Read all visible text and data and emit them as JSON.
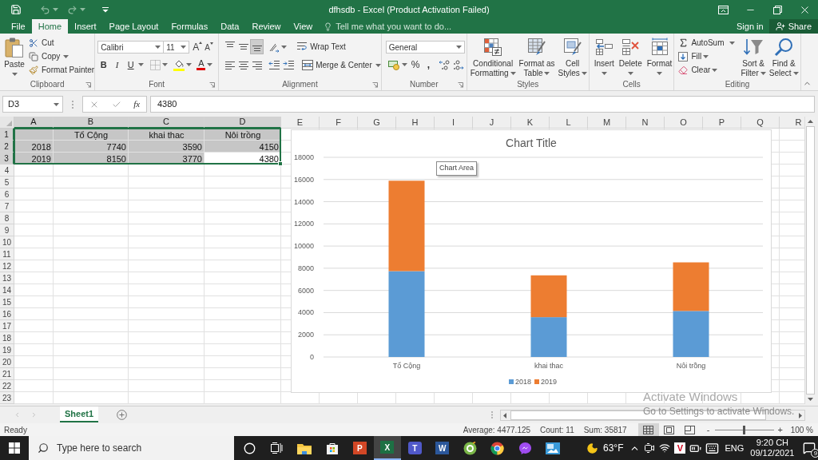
{
  "title_bar": {
    "title": "dfhsdb - Excel (Product Activation Failed)"
  },
  "ribbon_tabs": [
    {
      "label": "File",
      "selected": false
    },
    {
      "label": "Home",
      "selected": true
    },
    {
      "label": "Insert",
      "selected": false
    },
    {
      "label": "Page Layout",
      "selected": false
    },
    {
      "label": "Formulas",
      "selected": false
    },
    {
      "label": "Data",
      "selected": false
    },
    {
      "label": "Review",
      "selected": false
    },
    {
      "label": "View",
      "selected": false
    }
  ],
  "tell_me": {
    "placeholder": "Tell me what you want to do..."
  },
  "account": {
    "sign_in": "Sign in",
    "share": "Share"
  },
  "ribbon": {
    "clipboard": {
      "label": "Clipboard",
      "paste": "Paste",
      "cut": "Cut",
      "copy": "Copy",
      "format_painter": "Format Painter"
    },
    "font": {
      "label": "Font",
      "font_name": "Calibri",
      "font_size": "11",
      "grow": "A",
      "shrink": "A",
      "bold": "B",
      "italic": "I",
      "underline": "U",
      "font_color": "A"
    },
    "alignment": {
      "label": "Alignment",
      "vertical_align": [
        {
          "kind": "top",
          "selected": false
        },
        {
          "kind": "middle",
          "selected": false
        },
        {
          "kind": "bottom",
          "selected": true
        }
      ],
      "horizontal_align": [
        {
          "kind": "left",
          "selected": false
        },
        {
          "kind": "center",
          "selected": false
        },
        {
          "kind": "right",
          "selected": false
        }
      ],
      "wrap_text": "Wrap Text",
      "merge_center": "Merge & Center"
    },
    "number": {
      "label": "Number",
      "format": "General",
      "percent": "%",
      "comma": ","
    },
    "styles": {
      "label": "Styles",
      "buttons": [
        {
          "kind": "conditional",
          "lines": [
            "Conditional",
            "Formatting"
          ]
        },
        {
          "kind": "table",
          "lines": [
            "Format as",
            "Table"
          ]
        },
        {
          "kind": "cell_styles",
          "lines": [
            "Cell",
            "Styles"
          ]
        }
      ]
    },
    "cells": {
      "label": "Cells",
      "buttons": [
        {
          "kind": "insert",
          "label": "Insert"
        },
        {
          "kind": "delete",
          "label": "Delete"
        },
        {
          "kind": "format",
          "label": "Format"
        }
      ]
    },
    "editing": {
      "label": "Editing",
      "autosum": "AutoSum",
      "fill": "Fill",
      "clear": "Clear",
      "buttons": [
        {
          "kind": "sort",
          "lines": [
            "Sort &",
            "Filter"
          ]
        },
        {
          "kind": "find",
          "lines": [
            "Find &",
            "Select"
          ]
        }
      ]
    }
  },
  "formula_bar": {
    "name_box": "D3",
    "function_label": "fx",
    "value": "4380"
  },
  "sheet": {
    "columns": [
      {
        "label": "A",
        "selected": true
      },
      {
        "label": "B",
        "selected": true
      },
      {
        "label": "C",
        "selected": true
      },
      {
        "label": "D",
        "selected": true
      },
      {
        "label": "E",
        "selected": false
      },
      {
        "label": "F",
        "selected": false
      },
      {
        "label": "G",
        "selected": false
      },
      {
        "label": "H",
        "selected": false
      },
      {
        "label": "I",
        "selected": false
      },
      {
        "label": "J",
        "selected": false
      },
      {
        "label": "K",
        "selected": false
      },
      {
        "label": "L",
        "selected": false
      },
      {
        "label": "M",
        "selected": false
      },
      {
        "label": "N",
        "selected": false
      },
      {
        "label": "O",
        "selected": false
      },
      {
        "label": "P",
        "selected": false
      },
      {
        "label": "Q",
        "selected": false
      },
      {
        "label": "R",
        "selected": false
      }
    ],
    "rows": [
      {
        "label": "1",
        "selected": true,
        "cells": [
          {
            "selected": true,
            "active": false
          },
          {
            "text": "Tổ Cộng",
            "kind": "heading",
            "selected": true,
            "active": false
          },
          {
            "text": "khai thac",
            "kind": "heading",
            "selected": true,
            "active": false
          },
          {
            "text": "Nôi trồng",
            "kind": "heading",
            "selected": true,
            "active": false
          }
        ]
      },
      {
        "label": "2",
        "selected": true,
        "cells": [
          {
            "text": "2018",
            "kind": "number",
            "selected": true,
            "active": false
          },
          {
            "text": "7740",
            "kind": "number",
            "selected": true,
            "active": false
          },
          {
            "text": "3590",
            "kind": "number",
            "selected": true,
            "active": false
          },
          {
            "text": "4150",
            "kind": "number",
            "selected": true,
            "active": false
          }
        ]
      },
      {
        "label": "3",
        "selected": true,
        "cells": [
          {
            "text": "2019",
            "kind": "number",
            "selected": true,
            "active": false
          },
          {
            "text": "8150",
            "kind": "number",
            "selected": true,
            "active": false
          },
          {
            "text": "3770",
            "kind": "number",
            "selected": true,
            "active": false
          },
          {
            "text": "4380",
            "kind": "number",
            "selected": true,
            "active": true
          }
        ]
      },
      {
        "label": "4",
        "selected": false
      },
      {
        "label": "5",
        "selected": false
      },
      {
        "label": "6",
        "selected": false
      },
      {
        "label": "7",
        "selected": false
      },
      {
        "label": "8",
        "selected": false
      },
      {
        "label": "9",
        "selected": false
      },
      {
        "label": "10",
        "selected": false
      },
      {
        "label": "11",
        "selected": false
      },
      {
        "label": "12",
        "selected": false
      },
      {
        "label": "13",
        "selected": false
      },
      {
        "label": "14",
        "selected": false
      },
      {
        "label": "15",
        "selected": false
      },
      {
        "label": "16",
        "selected": false
      },
      {
        "label": "17",
        "selected": false
      },
      {
        "label": "18",
        "selected": false
      },
      {
        "label": "19",
        "selected": false
      },
      {
        "label": "20",
        "selected": false
      },
      {
        "label": "21",
        "selected": false
      },
      {
        "label": "22",
        "selected": false
      },
      {
        "label": "23",
        "selected": false
      }
    ]
  },
  "chart": {
    "tooltip": "Chart Area",
    "chart_data": {
      "type": "bar",
      "title": "Chart Title",
      "categories": [
        "Tổ Cộng",
        "khai thac",
        "Nôi trồng"
      ],
      "series": [
        {
          "name": "2018",
          "color": "#5b9bd5",
          "values": [
            7740,
            3590,
            4150
          ]
        },
        {
          "name": "2019",
          "color": "#ed7d31",
          "values": [
            8150,
            3770,
            4380
          ]
        }
      ],
      "ylim": [
        0,
        18000
      ],
      "yticks": [
        0,
        2000,
        4000,
        6000,
        8000,
        10000,
        12000,
        14000,
        16000,
        18000
      ],
      "stacked": true,
      "orientation": "vertical",
      "grid": true,
      "legend": true
    }
  },
  "sheet_tabs": [
    {
      "label": "Sheet1",
      "selected": true
    }
  ],
  "status_bar": {
    "mode": "Ready",
    "average": "Average: 4477.125",
    "count": "Count: 11",
    "sum": "Sum: 35817",
    "views": [
      {
        "kind": "normal",
        "selected": true
      },
      {
        "kind": "page_layout",
        "selected": false
      },
      {
        "kind": "page_break",
        "selected": false
      }
    ],
    "zoom": {
      "minus": "-",
      "plus": "+",
      "level": 0.5,
      "reading": "100 %"
    }
  },
  "taskbar": {
    "search": {
      "placeholder": "Type here to search"
    },
    "buttons": [
      {
        "kind": "cortana",
        "selected": false
      },
      {
        "kind": "task_view",
        "selected": false
      },
      {
        "kind": "folder",
        "selected": false
      },
      {
        "kind": "store",
        "selected": false
      },
      {
        "kind": "slides",
        "glyph": "P",
        "selected": false
      },
      {
        "kind": "sheets",
        "glyph": "X",
        "selected": true
      },
      {
        "kind": "meetings",
        "glyph": "T",
        "selected": false
      },
      {
        "kind": "docs",
        "glyph": "W",
        "selected": false
      },
      {
        "kind": "browser_green",
        "selected": false
      },
      {
        "kind": "browser",
        "selected": false
      },
      {
        "kind": "messenger",
        "selected": false
      },
      {
        "kind": "gallery",
        "selected": false
      }
    ],
    "weather": "63°F",
    "tray": [
      {
        "kind": "chevron"
      },
      {
        "kind": "camera"
      },
      {
        "kind": "wifi"
      },
      {
        "kind": "security",
        "glyph": "V"
      },
      {
        "kind": "battery"
      },
      {
        "kind": "keyboard"
      }
    ],
    "language": "ENG",
    "time": "9:20 CH",
    "date": "09/12/2021",
    "notification_count": "9"
  },
  "activation_notice": {
    "title": "Activate Windows",
    "message": "Go to Settings to activate Windows."
  }
}
